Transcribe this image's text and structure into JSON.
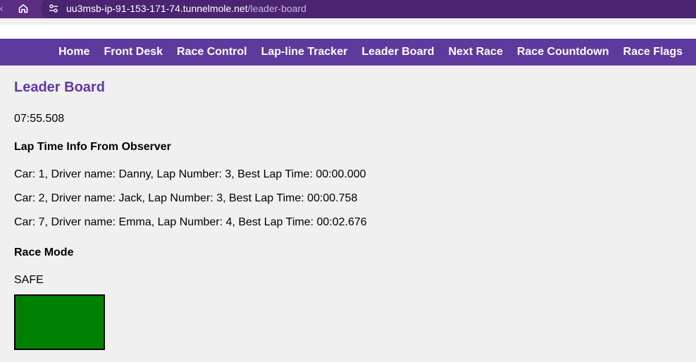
{
  "browser": {
    "url_host": "uu3msb-ip-91-153-171-74.tunnelmole.net",
    "url_path": "/leader-board",
    "home_icon": "home-icon",
    "site_info_icon": "tune-icon"
  },
  "nav": {
    "items": [
      {
        "label": "Home"
      },
      {
        "label": "Front Desk"
      },
      {
        "label": "Race Control"
      },
      {
        "label": "Lap-line Tracker"
      },
      {
        "label": "Leader Board"
      },
      {
        "label": "Next Race"
      },
      {
        "label": "Race Countdown"
      },
      {
        "label": "Race Flags"
      }
    ]
  },
  "main": {
    "title": "Leader Board",
    "timer": "07:55.508",
    "lap_heading": "Lap Time Info From Observer",
    "laps": [
      {
        "text": "Car: 1, Driver name: Danny, Lap Number: 3, Best Lap Time: 00:00.000"
      },
      {
        "text": "Car: 2, Driver name: Jack, Lap Number: 3, Best Lap Time: 00:00.758"
      },
      {
        "text": "Car: 7, Driver name: Emma, Lap Number: 4, Best Lap Time: 00:02.676"
      }
    ],
    "mode_heading": "Race Mode",
    "mode_value": "SAFE",
    "flag_color": "#008000"
  },
  "colors": {
    "browser_bar": "#5b2d83",
    "nav_bg": "#5e3a9e",
    "title_color": "#5e3a9e",
    "page_bg": "#f0f0f0"
  }
}
